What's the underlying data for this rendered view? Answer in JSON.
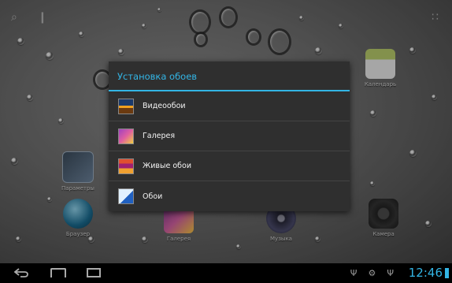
{
  "dialog": {
    "title": "Установка обоев",
    "items": [
      {
        "label": "Видеообои",
        "icon": "video-wallpaper-icon"
      },
      {
        "label": "Галерея",
        "icon": "gallery-icon"
      },
      {
        "label": "Живые обои",
        "icon": "live-wallpaper-icon"
      },
      {
        "label": "Обои",
        "icon": "wallpaper-icon"
      }
    ]
  },
  "home_apps": [
    {
      "label": "Календарь"
    },
    {
      "label": "Параметры"
    },
    {
      "label": "Браузер"
    },
    {
      "label": "Галерея"
    },
    {
      "label": "Музыка"
    },
    {
      "label": "Камера"
    }
  ],
  "statusbar": {
    "time": "12:46"
  },
  "colors": {
    "accent": "#33b5e5"
  }
}
